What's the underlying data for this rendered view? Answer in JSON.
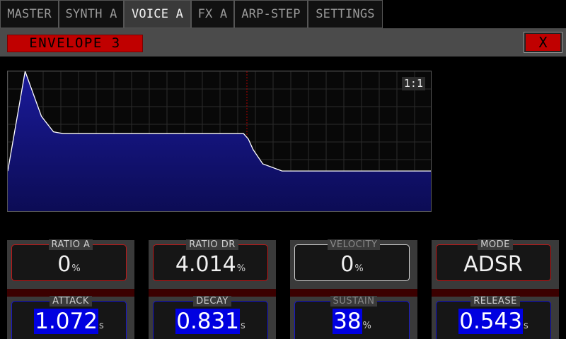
{
  "tabs": [
    {
      "label": "MASTER",
      "active": false
    },
    {
      "label": "SYNTH A",
      "active": false
    },
    {
      "label": "VOICE A",
      "active": true
    },
    {
      "label": "FX A",
      "active": false
    },
    {
      "label": "ARP-STEP",
      "active": false
    },
    {
      "label": "SETTINGS",
      "active": false
    }
  ],
  "header": {
    "title": "ENVELOPE 3",
    "close_label": "X"
  },
  "graph": {
    "ratio_label": "1:1"
  },
  "chart_data": {
    "type": "area",
    "description_keys": "envelope",
    "series": [
      {
        "x": [
          0,
          0.072,
          0.14,
          0.19,
          0.23,
          0.3,
          0.4,
          0.6,
          0.8,
          0.98,
          1.0,
          1.02,
          1.06,
          1.14,
          1.3,
          1.6,
          2.0
        ],
        "y": [
          0.16,
          1.0,
          0.62,
          0.49,
          0.475,
          0.475,
          0.475,
          0.475,
          0.475,
          0.475,
          0.43,
          0.34,
          0.22,
          0.16,
          0.16,
          0.16,
          0.16
        ]
      }
    ],
    "colors": {
      "fill": "#1c1c8c",
      "line": "#ffffff",
      "grid": "#2b2b2b",
      "marker": "#b00000"
    }
  },
  "params": [
    {
      "top_label": "RATIO A",
      "top_value": "0",
      "top_unit": "%",
      "bottom_label": "ATTACK",
      "bottom_value": "1.072",
      "bottom_unit": "s"
    },
    {
      "top_label": "RATIO DR",
      "top_value": "4.014",
      "top_unit": "%",
      "bottom_label": "DECAY",
      "bottom_value": "0.831",
      "bottom_unit": "s"
    },
    {
      "top_label": "VELOCITY",
      "top_value": "0",
      "top_unit": "%",
      "bottom_label": "SUSTAIN",
      "bottom_value": "38",
      "bottom_unit": "%"
    },
    {
      "top_label": "MODE",
      "top_value": "ADSR",
      "top_unit": "",
      "bottom_label": "RELEASE",
      "bottom_value": "0.543",
      "bottom_unit": "s"
    }
  ]
}
